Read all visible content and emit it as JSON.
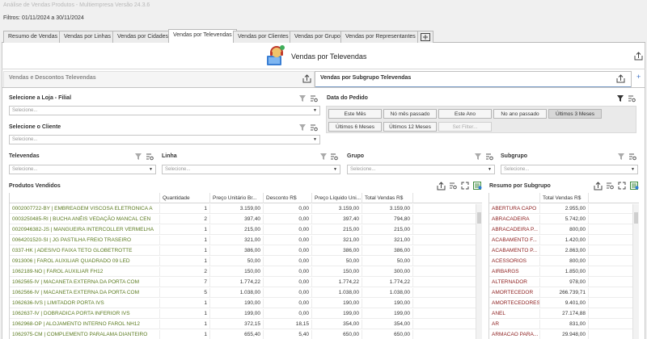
{
  "window_title": "Análise de Vendas Produtos - Multiempresa Versão 24.3.6",
  "filters_text": "Filtros: 01/11/2024 a 30/11/2024",
  "tabs": [
    {
      "label": "Resumo de Vendas"
    },
    {
      "label": "Vendas por Linhas"
    },
    {
      "label": "Vendas por Cidades"
    },
    {
      "label": "Vendas por Televendas"
    },
    {
      "label": "Vendas por Clientes"
    },
    {
      "label": "Vendas por Grupo"
    },
    {
      "label": "Vendas por Representantes"
    }
  ],
  "active_tab": "Vendas por Televendas",
  "page_title": "Vendas por Televendas",
  "panel_tabs": {
    "left": "Vendas e Descontos Televendas",
    "right": "Vendas por Subgrupo Televendas"
  },
  "loja": {
    "label": "Selecione a Loja - Filial",
    "placeholder": "Selecione..."
  },
  "cliente": {
    "label": "Selecione o Cliente",
    "placeholder": "Selecione..."
  },
  "data_pedido": {
    "label": "Data do Pedido",
    "buttons": [
      "Este Mês",
      "Nó mês passado",
      "Este Ano",
      "No ano passado",
      "Últimos 3 Meses",
      "Últimos 6 Meses",
      "Últimos 12 Meses",
      "Set Filter..."
    ],
    "selected": "Últimos 3 Meses"
  },
  "televendas": {
    "label": "Televendas",
    "placeholder": "Selecione..."
  },
  "linha": {
    "label": "Linha",
    "placeholder": "Selecione..."
  },
  "grupo": {
    "label": "Grupo",
    "placeholder": "Selecione..."
  },
  "subgrupo": {
    "label": "Subgrupo",
    "placeholder": "Selecione..."
  },
  "produtos": {
    "title": "Produtos Vendidos",
    "columns": [
      "",
      "Quantidade",
      "Preço Unitário Br...",
      "Desconto R$",
      "Preço Líquido Uni...",
      "Total Vendas R$"
    ],
    "rows": [
      [
        "0002007722-BY | EMBREAGEM VISCOSA ELETRONICA A",
        "1",
        "3.159,00",
        "0,00",
        "3.159,00",
        "3.159,00"
      ],
      [
        "0003250485-RI | BUCHA ANÉIS VEDAÇÃO MANCAL CEN",
        "2",
        "397,40",
        "0,00",
        "397,40",
        "794,80"
      ],
      [
        "0020946382-JS | MANGUEIRA INTERCOLLER VERMELHA",
        "1",
        "215,00",
        "0,00",
        "215,00",
        "215,00"
      ],
      [
        "0064201520-SI | JG PASTILHA FREIO TRASEIRO",
        "1",
        "321,00",
        "0,00",
        "321,00",
        "321,00"
      ],
      [
        "0337-HK | ADESIVO FAIXA TETO GLOBETROTTE",
        "1",
        "386,00",
        "0,00",
        "386,00",
        "386,00"
      ],
      [
        "0913006 | FAROL AUXILIAR QUADRADO 09 LED",
        "1",
        "50,00",
        "0,00",
        "50,00",
        "50,00"
      ],
      [
        "1062189-NO | FAROL AUXILIAR FH12",
        "2",
        "150,00",
        "0,00",
        "150,00",
        "300,00"
      ],
      [
        "1062565-IV | MACANETA EXTERNA DA PORTA COM",
        "7",
        "1.774,22",
        "0,00",
        "1.774,22",
        "1.774,22"
      ],
      [
        "1062566-IV | MACANETA EXTERNA DA PORTA COM",
        "5",
        "1.038,00",
        "0,00",
        "1.038,00",
        "1.038,00"
      ],
      [
        "1062636-IVS | LIMITADOR PORTA IVS",
        "1",
        "190,00",
        "0,00",
        "190,00",
        "190,00"
      ],
      [
        "1062637-IV | DOBRADICA PORTA INFERIOR IVS",
        "1",
        "199,00",
        "0,00",
        "199,00",
        "199,00"
      ],
      [
        "1062968-OP | ALOJAMENTO INTERNO FAROL NH12",
        "1",
        "372,15",
        "18,15",
        "354,00",
        "354,00"
      ],
      [
        "1062975-CM | COMPLEMENTO PARALAMA DIANTEIRO",
        "1",
        "655,40",
        "5,40",
        "650,00",
        "650,00"
      ]
    ]
  },
  "resumo": {
    "title": "Resumo por Subgrupo",
    "columns": [
      "",
      "Total Vendas R$"
    ],
    "rows": [
      [
        "ABERTURA CAPO",
        "2.955,00"
      ],
      [
        "ABRACADEIRA",
        "5.742,00"
      ],
      [
        "ABRACADEIRA P...",
        "800,00"
      ],
      [
        "ACABAMENTO F...",
        "1.420,00"
      ],
      [
        "ACABAMENTO P...",
        "2.863,00"
      ],
      [
        "ACESSORIOS",
        "800,00"
      ],
      [
        "AIRBARGS",
        "1.850,00"
      ],
      [
        "ALTERNADOR",
        "978,00"
      ],
      [
        "AMORTECEDOR",
        "266.739,71"
      ],
      [
        "AMORTECEDORES",
        "9.401,00"
      ],
      [
        "ANEL",
        "27.174,88"
      ],
      [
        "AR",
        "831,00"
      ],
      [
        "ARMACAO PARA...",
        "29.948,00"
      ]
    ]
  }
}
